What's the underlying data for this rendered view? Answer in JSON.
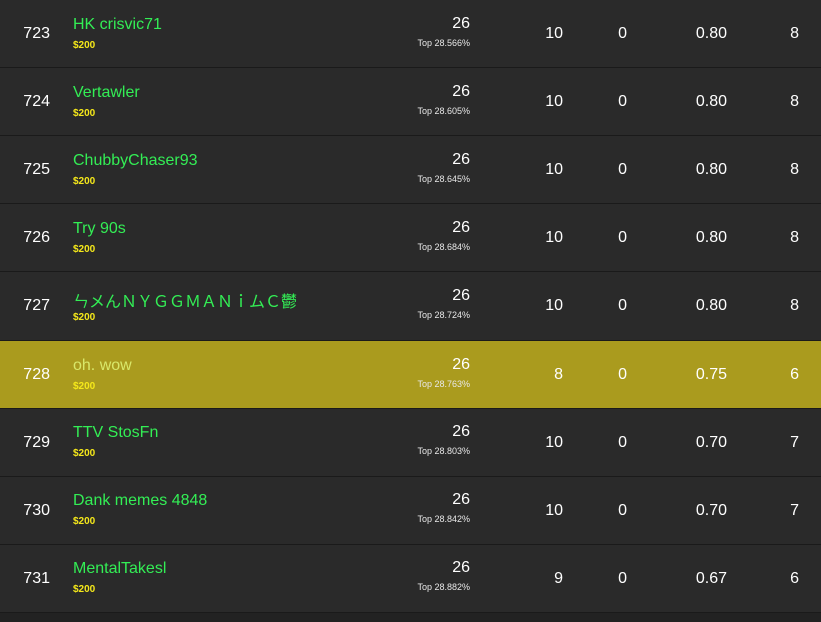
{
  "leaderboard": {
    "rows": [
      {
        "rank": "723",
        "name": "HK crisvic71",
        "prize": "$200",
        "points": "26",
        "top": "Top 28.566%",
        "c1": "10",
        "c2": "0",
        "c3": "0.80",
        "c4": "8",
        "highlighted": false
      },
      {
        "rank": "724",
        "name": "Vertawler",
        "prize": "$200",
        "points": "26",
        "top": "Top 28.605%",
        "c1": "10",
        "c2": "0",
        "c3": "0.80",
        "c4": "8",
        "highlighted": false
      },
      {
        "rank": "725",
        "name": "ChubbyChaser93",
        "prize": "$200",
        "points": "26",
        "top": "Top 28.645%",
        "c1": "10",
        "c2": "0",
        "c3": "0.80",
        "c4": "8",
        "highlighted": false
      },
      {
        "rank": "726",
        "name": "Try 90s",
        "prize": "$200",
        "points": "26",
        "top": "Top 28.684%",
        "c1": "10",
        "c2": "0",
        "c3": "0.80",
        "c4": "8",
        "highlighted": false
      },
      {
        "rank": "727",
        "name": "ㄣメんＮＹＧＧＭＡＮｉムＣ鬱",
        "prize": "$200",
        "points": "26",
        "top": "Top 28.724%",
        "c1": "10",
        "c2": "0",
        "c3": "0.80",
        "c4": "8",
        "highlighted": false
      },
      {
        "rank": "728",
        "name": "oh. wow",
        "prize": "$200",
        "points": "26",
        "top": "Top 28.763%",
        "c1": "8",
        "c2": "0",
        "c3": "0.75",
        "c4": "6",
        "highlighted": true
      },
      {
        "rank": "729",
        "name": "TTV StosFn",
        "prize": "$200",
        "points": "26",
        "top": "Top 28.803%",
        "c1": "10",
        "c2": "0",
        "c3": "0.70",
        "c4": "7",
        "highlighted": false
      },
      {
        "rank": "730",
        "name": "Dank memes 4848",
        "prize": "$200",
        "points": "26",
        "top": "Top 28.842%",
        "c1": "10",
        "c2": "0",
        "c3": "0.70",
        "c4": "7",
        "highlighted": false
      },
      {
        "rank": "731",
        "name": "MentalTakesl",
        "prize": "$200",
        "points": "26",
        "top": "Top 28.882%",
        "c1": "9",
        "c2": "0",
        "c3": "0.67",
        "c4": "6",
        "highlighted": false
      }
    ]
  },
  "colors": {
    "background": "#2a2a2a",
    "highlight_row": "#aa9b1e",
    "player_name": "#33ee55",
    "prize": "#f5e81a"
  }
}
